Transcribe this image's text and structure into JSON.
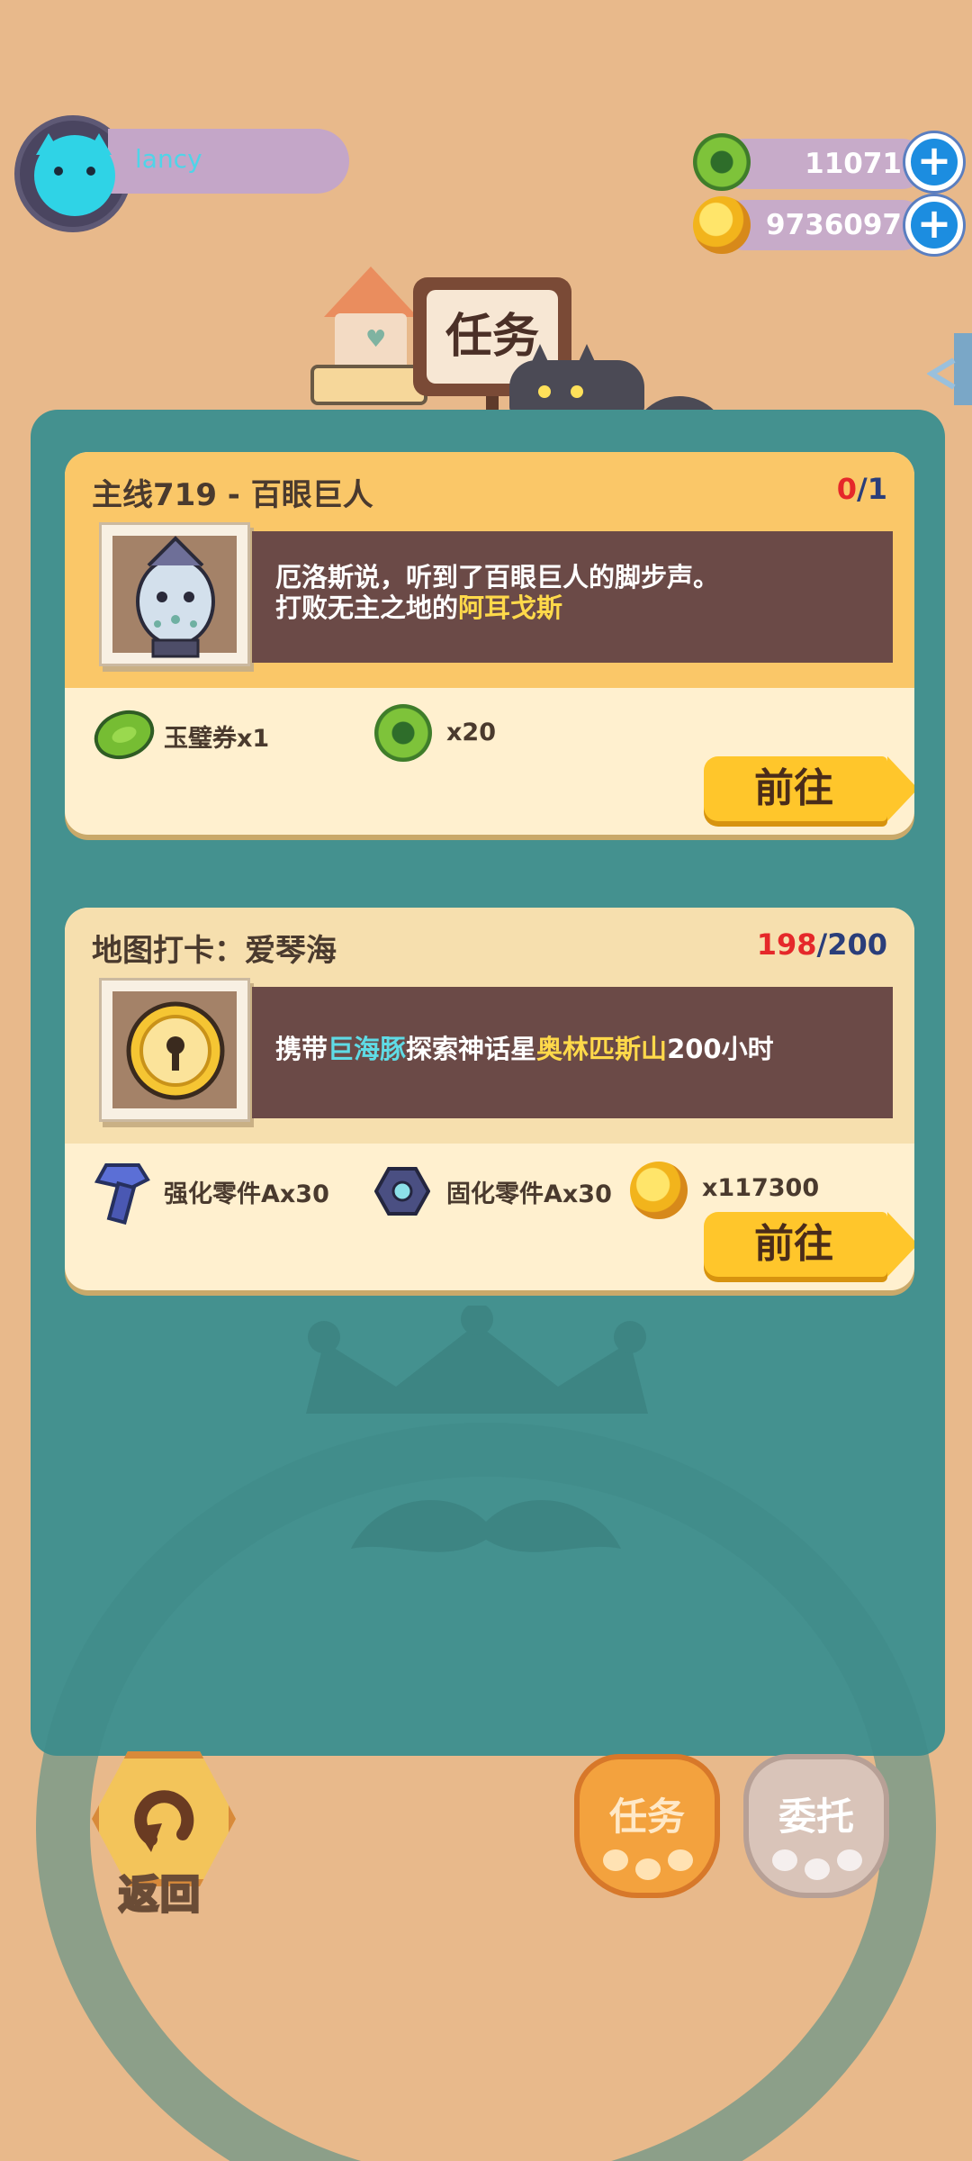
{
  "player": {
    "name": "lancy"
  },
  "currencies": {
    "jade": "11071",
    "gold": "9736097"
  },
  "header": {
    "sign_title": "任务"
  },
  "tasks": [
    {
      "title": "主线719 - 百眼巨人",
      "progress_current": "0",
      "progress_sep": "/",
      "progress_total": "1",
      "desc_line1": "厄洛斯说，听到了百眼巨人的脚步声。",
      "desc_line2_prefix": "打败无主之地的",
      "desc_line2_highlight": "阿耳戈斯",
      "rewards": [
        {
          "icon": "jade-voucher-icon",
          "label": "玉璧券x1"
        },
        {
          "icon": "jade-coin-icon",
          "label": "x20"
        }
      ],
      "go_label": "前往"
    },
    {
      "title": "地图打卡：爱琴海",
      "progress_current": "198",
      "progress_sep": "/",
      "progress_total": "200",
      "desc_p1": "携带",
      "desc_hl1": "巨海豚",
      "desc_p2": "探索神话星",
      "desc_hl2": "奥林匹斯山",
      "desc_p3": "200小时",
      "rewards": [
        {
          "icon": "bolt-icon",
          "label": "强化零件Ax30"
        },
        {
          "icon": "nut-icon",
          "label": "固化零件Ax30"
        },
        {
          "icon": "gold-coin-icon",
          "label": "x117300"
        }
      ],
      "go_label": "前往"
    }
  ],
  "bottom": {
    "back_label": "返回",
    "tab_tasks": "任务",
    "tab_commission": "委托"
  },
  "colors": {
    "background": "#e8b98b",
    "panel": "#44918f",
    "accent_yellow": "#ffc62b",
    "progress_red": "#e5282a"
  }
}
